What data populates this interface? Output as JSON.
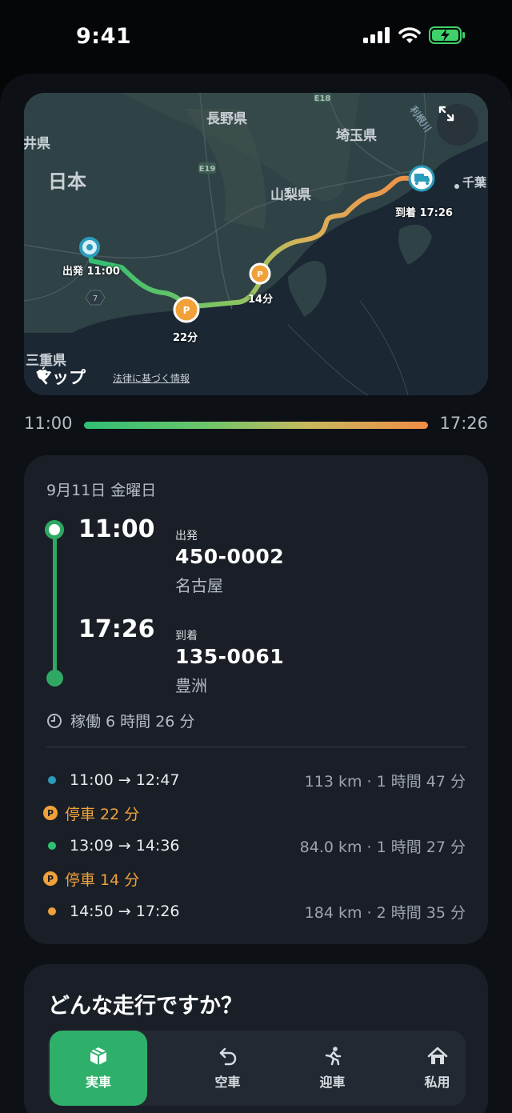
{
  "status_bar": {
    "time": "9:41"
  },
  "map": {
    "labels": {
      "nagano": "長野県",
      "fukui": "福井県",
      "saitama": "埼玉県",
      "japan": "日本",
      "yamanashi": "山梨県",
      "mie": "三重県",
      "chiba": "千葉",
      "tone": "利根川",
      "e18": "E18",
      "e19": "E19",
      "route7": "7"
    },
    "pins": {
      "start": "出発 11:00",
      "end": "到着 17:26",
      "park1": "22分",
      "park2": "14分",
      "park_glyph": "P"
    },
    "provider": "マップ",
    "legal": "法律に基づく情報"
  },
  "timeline": {
    "start": "11:00",
    "end": "17:26"
  },
  "trip": {
    "date": "9月11日 金曜日",
    "departure": {
      "time": "11:00",
      "kind": "出発",
      "code": "450-0002",
      "name": "名古屋"
    },
    "arrival": {
      "time": "17:26",
      "kind": "到着",
      "code": "135-0061",
      "name": "豊洲"
    },
    "duration": "稼働 6 時間 26 分",
    "segments": [
      {
        "type": "drive",
        "times": "11:00 → 12:47",
        "stats": "113 km · 1 時間 47 分",
        "color": "#2b9bbb"
      },
      {
        "type": "park",
        "text": "停車 22 分",
        "glyph": "P"
      },
      {
        "type": "drive",
        "times": "13:09 → 14:36",
        "stats": "84.0 km · 1 時間 27 分",
        "color": "#2fbf74"
      },
      {
        "type": "park",
        "text": "停車 14 分",
        "glyph": "P"
      },
      {
        "type": "drive",
        "times": "14:50 → 17:26",
        "stats": "184 km · 2 時間 35 分",
        "color": "#f0a13a"
      }
    ]
  },
  "trip_type": {
    "title": "どんな走行ですか？",
    "options": [
      {
        "label": "実車",
        "icon": "box-icon",
        "selected": true
      },
      {
        "label": "空車",
        "icon": "return-arrow-icon",
        "selected": false
      },
      {
        "label": "迎車",
        "icon": "running-person-icon",
        "selected": false
      },
      {
        "label": "私用",
        "icon": "home-icon",
        "selected": false
      }
    ]
  },
  "colors": {
    "accent_green": "#2fb06a",
    "park_orange": "#f0a13a",
    "card_bg": "#1a1f27"
  }
}
